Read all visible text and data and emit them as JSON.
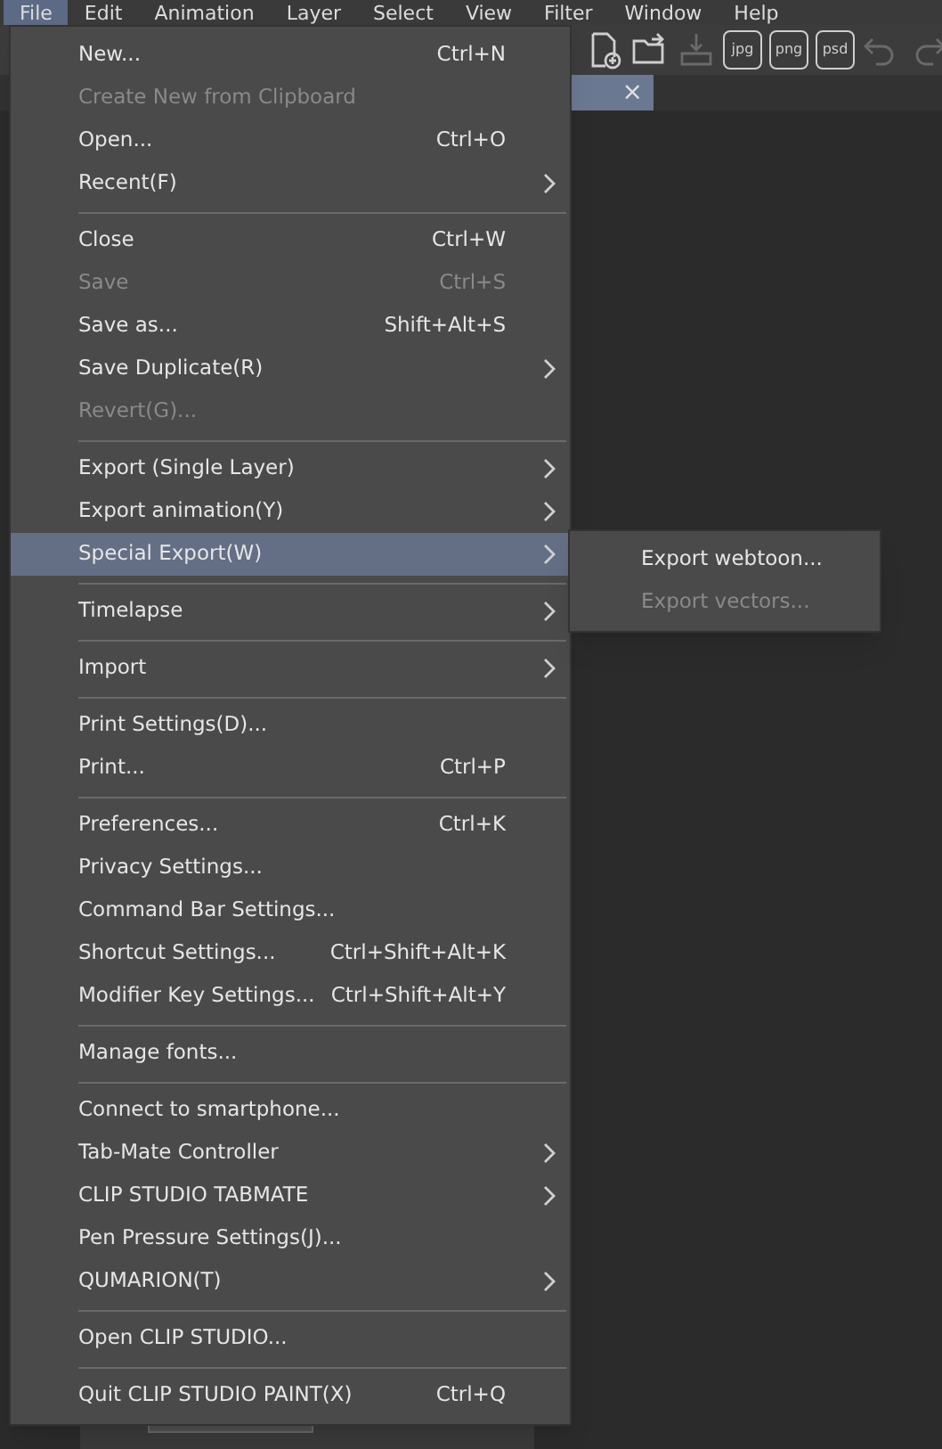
{
  "menubar": [
    {
      "label": "File",
      "selected": true
    },
    {
      "label": "Edit",
      "selected": false
    },
    {
      "label": "Animation",
      "selected": false
    },
    {
      "label": "Layer",
      "selected": false
    },
    {
      "label": "Select",
      "selected": false
    },
    {
      "label": "View",
      "selected": false
    },
    {
      "label": "Filter",
      "selected": false
    },
    {
      "label": "Window",
      "selected": false
    },
    {
      "label": "Help",
      "selected": false
    }
  ],
  "toolbar": [
    {
      "kind": "new"
    },
    {
      "kind": "open"
    },
    {
      "kind": "save",
      "disabled": true
    },
    {
      "kind": "file",
      "label": "jpg"
    },
    {
      "kind": "file",
      "label": "png"
    },
    {
      "kind": "file",
      "label": "psd"
    },
    {
      "kind": "undo",
      "disabled": true
    },
    {
      "kind": "redo",
      "disabled": true
    }
  ],
  "file_menu": [
    {
      "kind": "item",
      "label": "New...",
      "shortcut": "Ctrl+N",
      "disabled": false,
      "submenu": false,
      "selected": false
    },
    {
      "kind": "item",
      "label": "Create New from Clipboard",
      "disabled": true,
      "submenu": false,
      "selected": false
    },
    {
      "kind": "item",
      "label": "Open...",
      "shortcut": "Ctrl+O",
      "disabled": false,
      "submenu": false,
      "selected": false
    },
    {
      "kind": "item",
      "label": "Recent(F)",
      "disabled": false,
      "submenu": true,
      "selected": false
    },
    {
      "kind": "separator"
    },
    {
      "kind": "item",
      "label": "Close",
      "shortcut": "Ctrl+W",
      "disabled": false,
      "submenu": false,
      "selected": false
    },
    {
      "kind": "item",
      "label": "Save",
      "shortcut": "Ctrl+S",
      "disabled": true,
      "submenu": false,
      "selected": false
    },
    {
      "kind": "item",
      "label": "Save as...",
      "shortcut": "Shift+Alt+S",
      "disabled": false,
      "submenu": false,
      "selected": false
    },
    {
      "kind": "item",
      "label": "Save Duplicate(R)",
      "disabled": false,
      "submenu": true,
      "selected": false
    },
    {
      "kind": "item",
      "label": "Revert(G)...",
      "disabled": true,
      "submenu": false,
      "selected": false
    },
    {
      "kind": "separator"
    },
    {
      "kind": "item",
      "label": "Export (Single Layer)",
      "disabled": false,
      "submenu": true,
      "selected": false
    },
    {
      "kind": "item",
      "label": "Export animation(Y)",
      "disabled": false,
      "submenu": true,
      "selected": false
    },
    {
      "kind": "item",
      "label": "Special Export(W)",
      "disabled": false,
      "submenu": true,
      "selected": true
    },
    {
      "kind": "separator"
    },
    {
      "kind": "item",
      "label": "Timelapse",
      "disabled": false,
      "submenu": true,
      "selected": false
    },
    {
      "kind": "separator"
    },
    {
      "kind": "item",
      "label": "Import",
      "disabled": false,
      "submenu": true,
      "selected": false
    },
    {
      "kind": "separator"
    },
    {
      "kind": "item",
      "label": "Print Settings(D)...",
      "disabled": false,
      "submenu": false,
      "selected": false
    },
    {
      "kind": "item",
      "label": "Print...",
      "shortcut": "Ctrl+P",
      "disabled": false,
      "submenu": false,
      "selected": false
    },
    {
      "kind": "separator"
    },
    {
      "kind": "item",
      "label": "Preferences...",
      "shortcut": "Ctrl+K",
      "disabled": false,
      "submenu": false,
      "selected": false
    },
    {
      "kind": "item",
      "label": "Privacy Settings...",
      "disabled": false,
      "submenu": false,
      "selected": false
    },
    {
      "kind": "item",
      "label": "Command Bar Settings...",
      "disabled": false,
      "submenu": false,
      "selected": false
    },
    {
      "kind": "item",
      "label": "Shortcut Settings...",
      "shortcut": "Ctrl+Shift+Alt+K",
      "disabled": false,
      "submenu": false,
      "selected": false
    },
    {
      "kind": "item",
      "label": "Modifier Key Settings...",
      "shortcut": "Ctrl+Shift+Alt+Y",
      "disabled": false,
      "submenu": false,
      "selected": false
    },
    {
      "kind": "separator"
    },
    {
      "kind": "item",
      "label": "Manage fonts...",
      "disabled": false,
      "submenu": false,
      "selected": false
    },
    {
      "kind": "separator"
    },
    {
      "kind": "item",
      "label": "Connect to smartphone...",
      "disabled": false,
      "submenu": false,
      "selected": false
    },
    {
      "kind": "item",
      "label": "Tab-Mate Controller",
      "disabled": false,
      "submenu": true,
      "selected": false
    },
    {
      "kind": "item",
      "label": "CLIP STUDIO TABMATE",
      "disabled": false,
      "submenu": true,
      "selected": false
    },
    {
      "kind": "item",
      "label": "Pen Pressure Settings(J)...",
      "disabled": false,
      "submenu": false,
      "selected": false
    },
    {
      "kind": "item",
      "label": "QUMARION(T)",
      "disabled": false,
      "submenu": true,
      "selected": false
    },
    {
      "kind": "separator"
    },
    {
      "kind": "item",
      "label": "Open CLIP STUDIO...",
      "disabled": false,
      "submenu": false,
      "selected": false
    },
    {
      "kind": "separator"
    },
    {
      "kind": "item",
      "label": "Quit CLIP STUDIO PAINT(X)",
      "shortcut": "Ctrl+Q",
      "disabled": false,
      "submenu": false,
      "selected": false
    }
  ],
  "submenu": [
    {
      "label": "Export webtoon...",
      "disabled": false
    },
    {
      "label": "Export vectors...",
      "disabled": true
    }
  ],
  "close_tab": {
    "symbol": "×"
  }
}
